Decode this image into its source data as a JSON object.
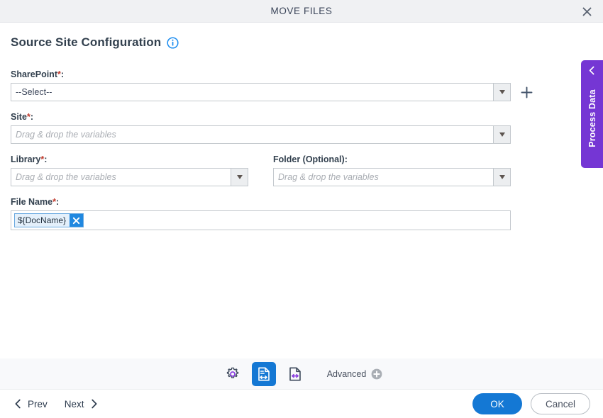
{
  "window": {
    "title": "MOVE FILES",
    "close_icon": "close-icon"
  },
  "page": {
    "heading": "Source Site Configuration",
    "info_icon": "info-icon"
  },
  "side_tab": {
    "label": "Process Data",
    "chevron_icon": "chevron-left-icon",
    "color": "#7536d4"
  },
  "form": {
    "sharepoint": {
      "label": "SharePoint",
      "required_marker": "*",
      "colon": ":",
      "value": "--Select--",
      "dropdown_icon": "caret-down-icon",
      "add_icon": "plus-icon"
    },
    "site": {
      "label": "Site",
      "required_marker": "*",
      "colon": ":",
      "placeholder": "Drag & drop the variables",
      "value": "",
      "dropdown_icon": "caret-down-icon"
    },
    "library": {
      "label": "Library",
      "required_marker": "*",
      "colon": ":",
      "placeholder": "Drag & drop the variables",
      "value": "",
      "dropdown_icon": "caret-down-icon"
    },
    "folder": {
      "label": "Folder (Optional)",
      "required_marker": "",
      "colon": ":",
      "placeholder": "Drag & drop the variables",
      "value": "",
      "dropdown_icon": "caret-down-icon"
    },
    "file_name": {
      "label": "File Name",
      "required_marker": "*",
      "colon": ":",
      "token": "${DocName}",
      "token_remove_icon": "close-icon"
    }
  },
  "toolbar": {
    "items": [
      {
        "name": "settings",
        "icon": "gear-icon",
        "active": false
      },
      {
        "name": "map-fields",
        "icon": "document-resize-icon",
        "active": true
      },
      {
        "name": "document-width",
        "icon": "document-arrows-icon",
        "active": false
      }
    ],
    "advanced_label": "Advanced",
    "advanced_icon": "plus-circle-icon"
  },
  "footer": {
    "prev_label": "Prev",
    "prev_icon": "chevron-left-icon",
    "next_label": "Next",
    "next_icon": "chevron-right-icon",
    "ok_label": "OK",
    "cancel_label": "Cancel",
    "primary_color": "#1478d4"
  }
}
